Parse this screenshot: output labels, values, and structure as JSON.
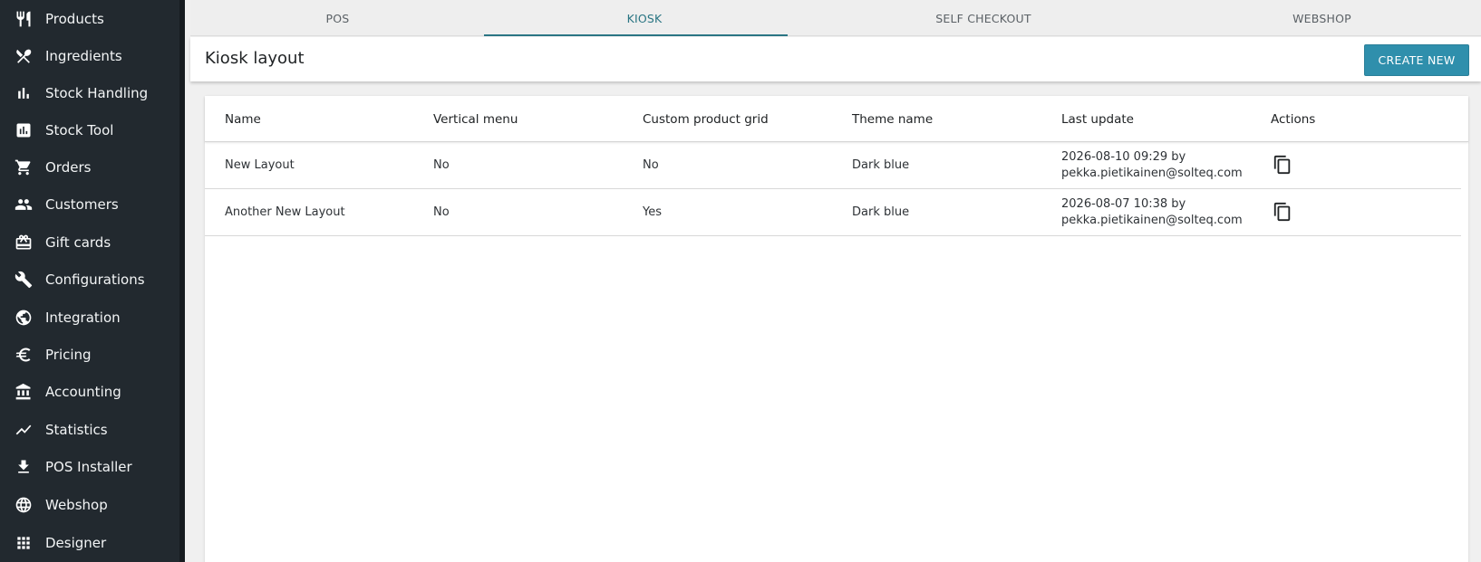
{
  "sidebar": {
    "items": [
      {
        "label": "Products",
        "icon": "utensils-icon"
      },
      {
        "label": "Ingredients",
        "icon": "fork-knife-cross-icon"
      },
      {
        "label": "Stock Handling",
        "icon": "bar-chart-icon"
      },
      {
        "label": "Stock Tool",
        "icon": "chart-box-icon"
      },
      {
        "label": "Orders",
        "icon": "cart-icon"
      },
      {
        "label": "Customers",
        "icon": "people-icon"
      },
      {
        "label": "Gift cards",
        "icon": "gift-card-icon"
      },
      {
        "label": "Configurations",
        "icon": "wrench-icon"
      },
      {
        "label": "Integration",
        "icon": "globe-link-icon"
      },
      {
        "label": "Pricing",
        "icon": "euro-icon"
      },
      {
        "label": "Accounting",
        "icon": "bank-icon"
      },
      {
        "label": "Statistics",
        "icon": "trend-line-icon"
      },
      {
        "label": "POS Installer",
        "icon": "download-icon"
      },
      {
        "label": "Webshop",
        "icon": "globe-icon"
      },
      {
        "label": "Designer",
        "icon": "grid-icon"
      }
    ]
  },
  "tabs": [
    {
      "label": "POS",
      "active": false
    },
    {
      "label": "KIOSK",
      "active": true
    },
    {
      "label": "SELF CHECKOUT",
      "active": false
    },
    {
      "label": "WEBSHOP",
      "active": false
    }
  ],
  "header": {
    "title": "Kiosk layout",
    "create_label": "CREATE NEW"
  },
  "table": {
    "columns": [
      "Name",
      "Vertical menu",
      "Custom product grid",
      "Theme name",
      "Last update",
      "Actions"
    ],
    "rows": [
      {
        "name": "New Layout",
        "vertical_menu": "No",
        "custom_grid": "No",
        "theme": "Dark blue",
        "updated": "2026-08-10 09:29 by",
        "updated_by": "pekka.pietikainen@solteq.com"
      },
      {
        "name": "Another New Layout",
        "vertical_menu": "No",
        "custom_grid": "Yes",
        "theme": "Dark blue",
        "updated": "2026-08-07 10:38 by",
        "updated_by": "pekka.pietikainen@solteq.com"
      }
    ]
  },
  "colors": {
    "sidebar_bg": "#22292f",
    "accent": "#2a7583",
    "button_bg": "#2f8fac"
  }
}
